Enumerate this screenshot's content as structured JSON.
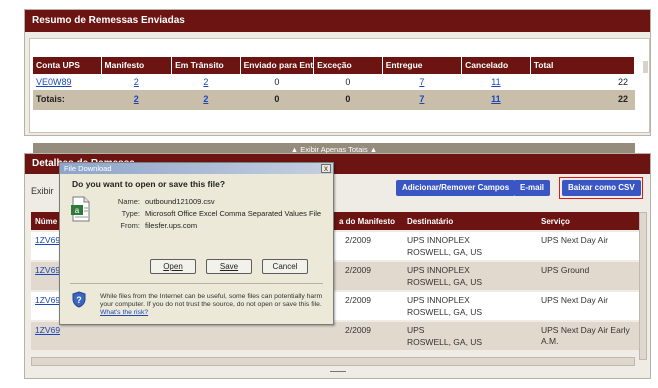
{
  "summary_panel": {
    "title": "Resumo de Remessas Enviadas",
    "columns": [
      "Conta UPS",
      "Manifesto",
      "Em Trânsito",
      "Enviado para Enti",
      "Exceção",
      "Entregue",
      "Cancelado",
      "Total"
    ],
    "row": {
      "account": "VE0W89",
      "manifest": "2",
      "in_transit": "2",
      "sent": "0",
      "exception": "0",
      "delivered": "7",
      "cancelled": "11",
      "total": "22"
    },
    "totals": {
      "label": "Totais:",
      "manifest": "2",
      "in_transit": "2",
      "sent": "0",
      "exception": "0",
      "delivered": "7",
      "cancelled": "11",
      "total": "22"
    },
    "expand_label": "▲ Exibir Apenas Totais ▲"
  },
  "details_panel": {
    "title": "Detalhes de Remessa",
    "exibir_label": "Exibir",
    "buttons": {
      "add_remove": "Adicionar/Remover Campos",
      "email": "E-mail",
      "csv": "Baixar como CSV"
    },
    "columns": {
      "name": "Núme",
      "manifest_date": "a do Manifesto",
      "recipient": "Destinatário",
      "service": "Serviço"
    },
    "rows": [
      {
        "id": "1ZV69",
        "date": "2/2009",
        "recipient": "UPS INNOPLEX",
        "location": "ROSWELL, GA, US",
        "service": "UPS Next Day Air"
      },
      {
        "id": "1ZV69",
        "date": "2/2009",
        "recipient": "UPS INNOPLEX",
        "location": "ROSWELL, GA, US",
        "service": "UPS Ground"
      },
      {
        "id": "1ZV69",
        "date": "2/2009",
        "recipient": "UPS INNOPLEX",
        "location": "ROSWELL, GA, US",
        "service": "UPS Next Day Air"
      },
      {
        "id": "1ZV69",
        "date": "2/2009",
        "recipient": "UPS",
        "location": "ROSWELL, GA, US",
        "service": "UPS Next Day Air Early A.M."
      }
    ]
  },
  "dialog": {
    "title": "File Download",
    "question": "Do you want to open or save this file?",
    "name_label": "Name:",
    "name_value": "outbound121009.csv",
    "type_label": "Type:",
    "type_value": "Microsoft Office Excel Comma Separated Values File",
    "from_label": "From:",
    "from_value": "filesfer.ups.com",
    "open_label": "Open",
    "save_label": "Save",
    "cancel_label": "Cancel",
    "warning": "While files from the Internet can be useful, some files can potentially harm your computer. If you do not trust the source, do not open or save this file.",
    "risk_link": "What's the risk?",
    "close_glyph": "x"
  },
  "colors": {
    "header": "#6b1411",
    "button": "#3a56c4",
    "highlight": "#e01818"
  }
}
